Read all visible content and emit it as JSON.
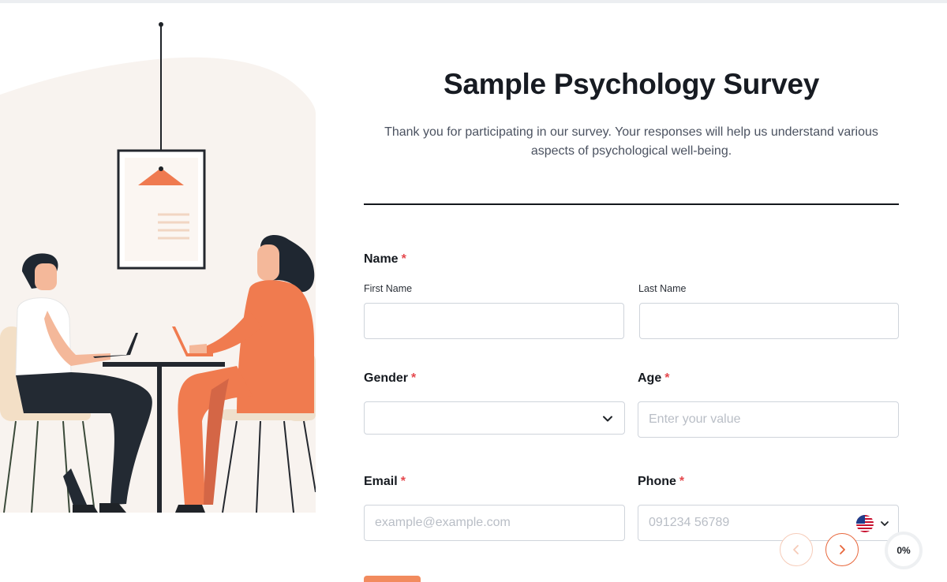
{
  "header": {
    "title": "Sample Psychology Survey",
    "description": "Thank you for participating in our survey. Your responses will help us understand various aspects of psychological well-being."
  },
  "fields": {
    "name": {
      "label": "Name",
      "required_mark": "*",
      "first_label": "First Name",
      "first_value": "",
      "last_label": "Last Name",
      "last_value": ""
    },
    "gender": {
      "label": "Gender",
      "required_mark": "*",
      "selected": ""
    },
    "age": {
      "label": "Age",
      "required_mark": "*",
      "placeholder": "Enter your value"
    },
    "email": {
      "label": "Email",
      "required_mark": "*",
      "placeholder": "example@example.com"
    },
    "phone": {
      "label": "Phone",
      "required_mark": "*",
      "placeholder": "091234 56789",
      "country_icon": "us-flag-icon"
    }
  },
  "navigation": {
    "prev_icon": "chevron-left-icon",
    "next_icon": "chevron-right-icon"
  },
  "progress": {
    "text": "0%",
    "value": 0
  },
  "colors": {
    "accent": "#e8673c",
    "required": "#e5484d",
    "divider": "#14171c"
  }
}
